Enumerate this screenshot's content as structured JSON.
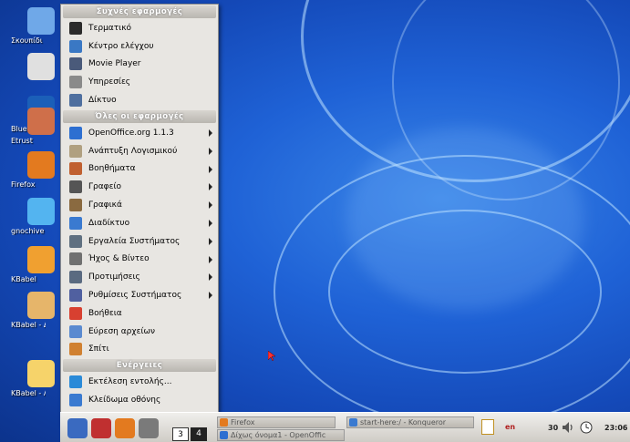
{
  "desktop": {
    "icons": [
      {
        "label": "Σκουπίδι",
        "icon": "trash-icon",
        "color": "#6fa8e8"
      },
      {
        "label": "",
        "icon": "gnu-icon",
        "color": "#e0e0e0"
      },
      {
        "label": "Bluefish",
        "icon": "bluefish-icon",
        "color": "#1b5fb8"
      },
      {
        "label": "Etrust",
        "icon": "etrust-icon",
        "color": "#cf6f4a"
      },
      {
        "label": "Firefox",
        "icon": "firefox-icon",
        "color": "#e37a1f"
      },
      {
        "label": "gnochive",
        "icon": "gear-icon",
        "color": "#53b4f0"
      },
      {
        "label": "KBabel",
        "icon": "kbabel-icon",
        "color": "#f0a030"
      },
      {
        "label": "KBabel - Διαχειριστ κατάλογυ",
        "icon": "kbabel-catalog-icon",
        "color": "#e6b56a"
      },
      {
        "label": "KBabel - Λ",
        "icon": "kbabel-dict-icon",
        "color": "#f6d36a"
      }
    ]
  },
  "menu": {
    "sections": {
      "favorites": "Συχνές εφαρμογές",
      "all": "Όλες οι εφαρμογές",
      "actions": "Ενέργειες"
    },
    "favorites": [
      {
        "label": "Τερματικό",
        "icon": "terminal-icon",
        "color": "#2b2b2b"
      },
      {
        "label": "Κέντρο ελέγχου",
        "icon": "control-center-icon",
        "color": "#3a78c4"
      },
      {
        "label": "Movie Player",
        "icon": "movie-player-icon",
        "color": "#4a5a7a"
      },
      {
        "label": "Υπηρεσίες",
        "icon": "services-icon",
        "color": "#8a8a8a"
      },
      {
        "label": "Δίκτυο",
        "icon": "network-icon",
        "color": "#4f6f9f"
      }
    ],
    "apps": [
      {
        "label": "OpenOffice.org 1.1.3",
        "icon": "openoffice-icon",
        "color": "#2d6fd1",
        "submenu": true
      },
      {
        "label": "Ανάπτυξη Λογισμικού",
        "icon": "development-icon",
        "color": "#b0a080",
        "submenu": true
      },
      {
        "label": "Βοηθήματα",
        "icon": "accessories-icon",
        "color": "#c06030",
        "submenu": true
      },
      {
        "label": "Γραφείο",
        "icon": "office-icon",
        "color": "#555555",
        "submenu": true
      },
      {
        "label": "Γραφικά",
        "icon": "graphics-icon",
        "color": "#8a6a40",
        "submenu": true
      },
      {
        "label": "Διαδίκτυο",
        "icon": "internet-icon",
        "color": "#3a7ad0",
        "submenu": true
      },
      {
        "label": "Εργαλεία Συστήματος",
        "icon": "system-tools-icon",
        "color": "#607080",
        "submenu": true
      },
      {
        "label": "Ήχος & Βίντεο",
        "icon": "sound-video-icon",
        "color": "#707070",
        "submenu": true
      },
      {
        "label": "Προτιμήσεις",
        "icon": "preferences-icon",
        "color": "#5a6a80",
        "submenu": true
      },
      {
        "label": "Ρυθμίσεις Συστήματος",
        "icon": "system-settings-icon",
        "color": "#5060a0",
        "submenu": true
      },
      {
        "label": "Βοήθεια",
        "icon": "help-icon",
        "color": "#d84030",
        "submenu": false
      },
      {
        "label": "Εύρεση αρχείων",
        "icon": "find-files-icon",
        "color": "#5a8ad0",
        "submenu": false
      },
      {
        "label": "Σπίτι",
        "icon": "home-icon",
        "color": "#d08030",
        "submenu": false
      }
    ],
    "actions": [
      {
        "label": "Εκτέλεση εντολής...",
        "icon": "run-icon",
        "color": "#2a8ad8"
      },
      {
        "label": "Κλείδωμα οθόνης",
        "icon": "lock-screen-icon",
        "color": "#3a7ad0"
      },
      {
        "label": "Αποσύνδεση...",
        "icon": "logout-icon",
        "color": "#d04030"
      }
    ]
  },
  "taskbar": {
    "quick_launch": [
      {
        "icon": "foot-menu-icon",
        "color": "#3a6ac0"
      },
      {
        "icon": "browser-icon",
        "color": "#c03030"
      },
      {
        "icon": "firefox-icon",
        "color": "#e37a1f"
      },
      {
        "icon": "mail-icon",
        "color": "#7a7a7a"
      }
    ],
    "pager": [
      "3",
      "4"
    ],
    "tasks": [
      {
        "label": "Firefox",
        "icon": "firefox-icon",
        "color": "#e37a1f"
      },
      {
        "label": "Δίχως όνομα1 - OpenOffic",
        "icon": "openoffice-icon",
        "color": "#2d6fd1"
      },
      {
        "label": "start-here:/ - Konqueror",
        "icon": "konqueror-icon",
        "color": "#3a7ad0"
      }
    ],
    "tray": {
      "keyboard": "en",
      "volume_level": "30",
      "clock": "23:06"
    }
  }
}
